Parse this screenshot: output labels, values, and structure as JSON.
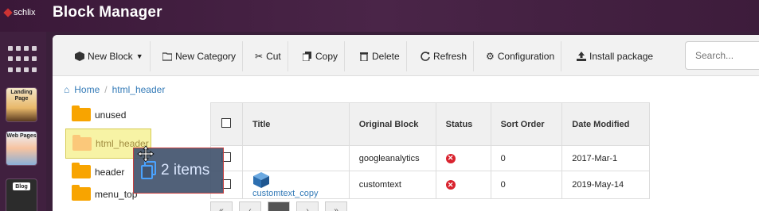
{
  "brand": {
    "name": "schlix"
  },
  "app": {
    "title": "Block Manager"
  },
  "dock": {
    "thumbs": [
      {
        "label": "Landing Page"
      },
      {
        "label": "Web Pages"
      },
      {
        "label": "Blog"
      }
    ]
  },
  "toolbar": {
    "new_block": "New Block",
    "new_category": "New Category",
    "cut": "Cut",
    "copy": "Copy",
    "delete": "Delete",
    "refresh": "Refresh",
    "configuration": "Configuration",
    "install_package": "Install package",
    "search_placeholder": "Search..."
  },
  "breadcrumb": {
    "home": "Home",
    "current": "html_header"
  },
  "tree": {
    "folders": [
      "unused",
      "html_header",
      "header",
      "menu_top"
    ]
  },
  "table": {
    "headers": [
      "Title",
      "Original Block",
      "Status",
      "Sort Order",
      "Date Modified"
    ],
    "rows": [
      {
        "title": "",
        "original": "googleanalytics",
        "status": "error",
        "sort": "0",
        "date": "2017-Mar-1"
      },
      {
        "title": "customtext_copy",
        "original": "customtext",
        "status": "error",
        "sort": "0",
        "date": "2019-May-14"
      }
    ]
  },
  "drag": {
    "label": "2 items"
  },
  "colors": {
    "accent": "#337ab7",
    "folder": "#f8a400",
    "topbar": "#3a1838",
    "error": "#d9232e"
  }
}
